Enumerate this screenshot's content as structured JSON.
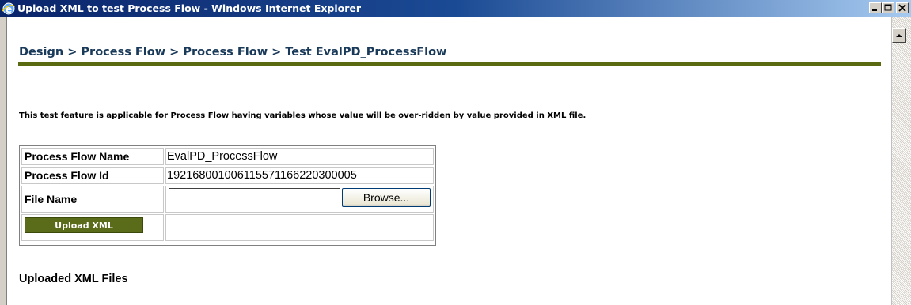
{
  "window": {
    "title": "Upload XML to test Process Flow - Windows Internet Explorer",
    "minimize_icon": "minimize-icon",
    "maximize_icon": "maximize-icon",
    "close_icon": "close-icon",
    "app_icon": "internet-explorer-icon"
  },
  "breadcrumb": "Design > Process Flow > Process Flow > Test EvalPD_ProcessFlow",
  "note": "This test feature is applicable for Process Flow having variables whose value will be over-ridden by value provided in XML file.",
  "form": {
    "rows": [
      {
        "label": "Process Flow Name",
        "value": "EvalPD_ProcessFlow"
      },
      {
        "label": "Process Flow Id",
        "value": "192168001006115571166220300005"
      },
      {
        "label": "File Name",
        "value": ""
      }
    ],
    "file_input_value": "",
    "browse_label": "Browse...",
    "upload_label": "Upload XML"
  },
  "uploaded_heading": "Uploaded XML Files",
  "colors": {
    "accent_olive": "#5a6a10",
    "breadcrumb_text": "#1a3a5a",
    "titlebar": "#0a246a"
  }
}
